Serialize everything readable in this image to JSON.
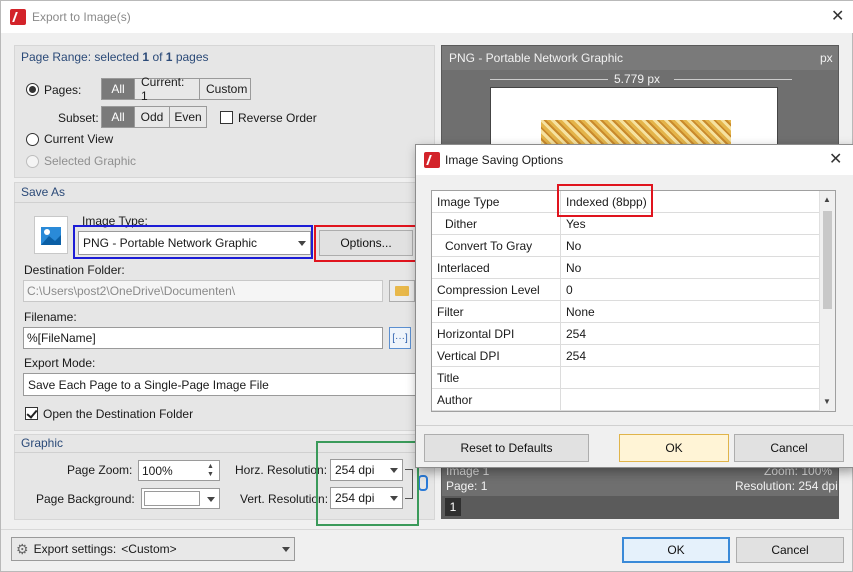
{
  "window": {
    "title": "Export to Image(s)"
  },
  "page_range": {
    "heading_prefix": "Page Range: selected ",
    "selected": "1",
    "of": " of ",
    "total": "1",
    "pages_suffix": " pages",
    "pages_label": "Pages:",
    "pages_options": [
      "All",
      "Current: 1",
      "Custom"
    ],
    "subset_label": "Subset:",
    "subset_options": [
      "All",
      "Odd",
      "Even"
    ],
    "reverse_order": "Reverse Order",
    "current_view": "Current View",
    "selected_graphic": "Selected Graphic"
  },
  "save_as": {
    "heading": "Save As",
    "image_type_label": "Image Type:",
    "image_type_value": "PNG - Portable Network Graphic",
    "options_button": "Options...",
    "dest_folder_label": "Destination Folder:",
    "dest_folder_value": "C:\\Users\\post2\\OneDrive\\Documenten\\",
    "filename_label": "Filename:",
    "filename_value": "%[FileName]",
    "export_mode_label": "Export Mode:",
    "export_mode_value": "Save Each Page to a Single-Page Image File",
    "open_folder": "Open the Destination Folder"
  },
  "graphic": {
    "heading": "Graphic",
    "page_zoom_label": "Page Zoom:",
    "page_zoom_value": "100%",
    "page_bg_label": "Page Background:",
    "horz_res_label": "Horz. Resolution:",
    "horz_res_value": "254 dpi",
    "vert_res_label": "Vert. Resolution:",
    "vert_res_value": "254 dpi"
  },
  "preview": {
    "header": "PNG - Portable Network Graphic",
    "unit": "px",
    "width_dim": "5.779 px",
    "footer_left": "Image 1",
    "footer_right": "Zoom: 100%",
    "page_label": "Page: 1",
    "resolution_label": "Resolution: 254 dpi",
    "page_num": "1"
  },
  "footer": {
    "export_settings_label": "Export settings:",
    "export_settings_value": "<Custom>",
    "ok": "OK",
    "cancel": "Cancel"
  },
  "dialog": {
    "title": "Image Saving Options",
    "rows": [
      {
        "key": "Image Type",
        "value": "Indexed (8bpp)"
      },
      {
        "key": "Dither",
        "value": "Yes"
      },
      {
        "key": "Convert To Gray",
        "value": "No"
      },
      {
        "key": "Interlaced",
        "value": "No"
      },
      {
        "key": "Compression Level",
        "value": "0"
      },
      {
        "key": "Filter",
        "value": "None"
      },
      {
        "key": "Horizontal DPI",
        "value": "254"
      },
      {
        "key": "Vertical DPI",
        "value": "254"
      },
      {
        "key": "Title",
        "value": ""
      },
      {
        "key": "Author",
        "value": ""
      }
    ],
    "reset": "Reset to Defaults",
    "ok": "OK",
    "cancel": "Cancel"
  },
  "colors": {
    "highlight_red": "#e0141e",
    "highlight_blue": "#1c1cd6",
    "highlight_green": "#3a9a5a",
    "accent": "#2b4a78"
  }
}
